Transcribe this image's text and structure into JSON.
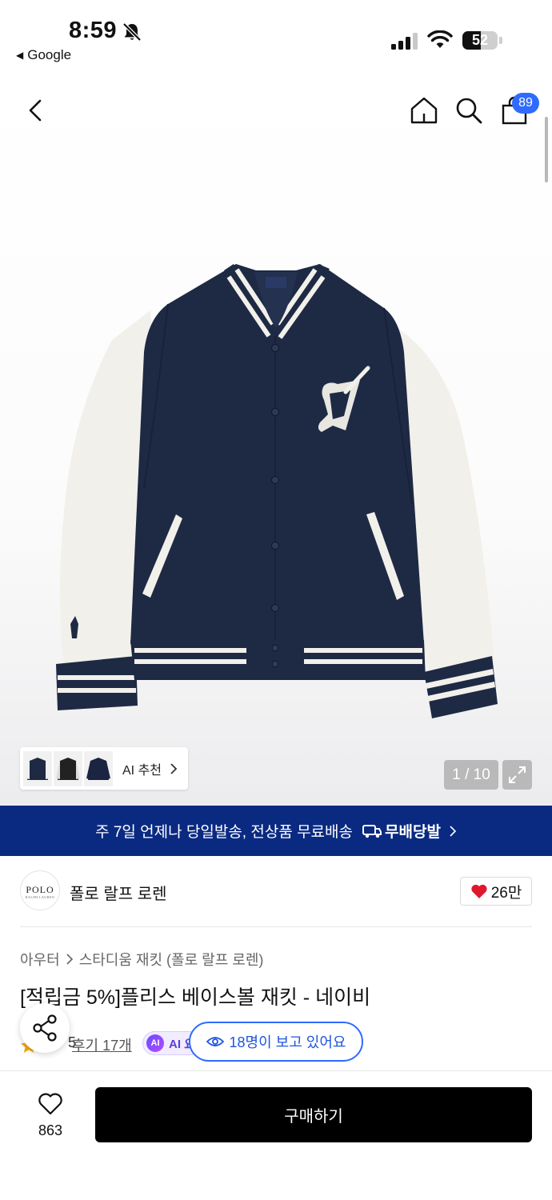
{
  "status_bar": {
    "time": "8:59",
    "back_app": "Google",
    "battery": "52",
    "battery_level": 0.52
  },
  "header": {
    "cart_count": "89"
  },
  "gallery": {
    "ai_recommend_label": "AI 추천",
    "image_counter": "1 / 10"
  },
  "shipping_banner": {
    "text": "주 7일 언제나 당일발송, 전상품 무료배송",
    "badge": "무배당발"
  },
  "brand": {
    "logo_text": "POLO",
    "logo_subtext": "RALPH LAUREN",
    "name": "폴로 랄프 로렌",
    "likes": "26만"
  },
  "breadcrumb": {
    "category": "아우터",
    "subcategory": "스타디움 재킷 (폴로 랄프 로렌)"
  },
  "product": {
    "title": "[적립금 5%]플리스 베이스볼 재킷 - 네이비",
    "rating_partial": "5",
    "review_link": "후기 17개",
    "ai_summary_label": "AI 요"
  },
  "viewers_badge": "18명이 보고 있어요",
  "bottom_bar": {
    "wishlist_count": "863",
    "buy_label": "구매하기"
  },
  "colors": {
    "banner_bg": "#0a2a82",
    "accent_blue": "#2f6bff",
    "jacket_navy": "#1e2a44",
    "sleeve_cream": "#f2f0ea",
    "heart_red": "#e0182d"
  }
}
